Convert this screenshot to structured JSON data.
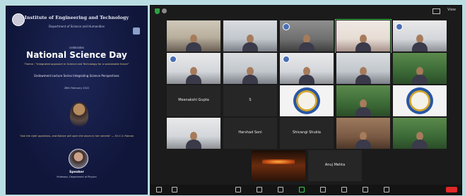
{
  "poster": {
    "institute": "Institute of Engineering and Technology",
    "department": "Department of Science and Humanities",
    "celebrates": "celebrates",
    "event_title": "National Science Day",
    "theme": "Theme : \"Integrated approach in Science and Technology for a sustainable future\"",
    "lecture": "Endowment Lecture Series Integrating Science Perspectives",
    "date": "28th February 2022",
    "quote": "\"Ask the right questions, and Nature will open the doors to her secrets\" — Sir C.V. Raman",
    "speaker_name": "Speaker",
    "speaker_role": "Professor, Department of Physics"
  },
  "meeting": {
    "view_label": "View",
    "tiles": [
      {
        "name": "",
        "style": "bg-room-a",
        "type": "person"
      },
      {
        "name": "",
        "style": "bg-room-b",
        "type": "person"
      },
      {
        "name": "",
        "style": "bg-room-c",
        "type": "logo-person"
      },
      {
        "name": "",
        "style": "bg-room-d",
        "type": "person",
        "active": true
      },
      {
        "name": "",
        "style": "bg-room-e",
        "type": "logo-person"
      },
      {
        "name": "",
        "style": "bg-room-e",
        "type": "logo-person"
      },
      {
        "name": "",
        "style": "bg-room-b",
        "type": "person"
      },
      {
        "name": "",
        "style": "bg-room-e",
        "type": "logo-person"
      },
      {
        "name": "",
        "style": "bg-room-b",
        "type": "person"
      },
      {
        "name": "",
        "style": "bg-green",
        "type": "person"
      },
      {
        "name": "Meenakshi Gupta",
        "style": "",
        "type": "text"
      },
      {
        "name": "S",
        "style": "",
        "type": "text"
      },
      {
        "name": "",
        "style": "bg-white",
        "type": "seal"
      },
      {
        "name": "",
        "style": "bg-green",
        "type": "person"
      },
      {
        "name": "",
        "style": "bg-white",
        "type": "seal"
      },
      {
        "name": "",
        "style": "bg-room-e",
        "type": "person"
      },
      {
        "name": "Harshad Soni",
        "style": "",
        "type": "text"
      },
      {
        "name": "Shivangi Shukla",
        "style": "",
        "type": "text"
      },
      {
        "name": "",
        "style": "bg-warm",
        "type": "person"
      },
      {
        "name": "",
        "style": "bg-green",
        "type": "person"
      },
      {
        "name": "",
        "style": "bg-orange",
        "type": "glow"
      },
      {
        "name": "Anuj Mehta",
        "style": "",
        "type": "text"
      }
    ]
  },
  "colors": {
    "page_bg": "#b9dde2",
    "poster_bg": "#10163a",
    "accent_gold": "#e0c98a",
    "zoom_bg": "#1b1b1b",
    "active_speaker": "#37d14f",
    "end_button": "#e02828"
  },
  "icons": [
    "shield-icon",
    "info-icon",
    "view-icon",
    "mic-icon",
    "video-icon",
    "security-icon",
    "participants-icon",
    "chat-icon",
    "share-screen-icon",
    "record-icon",
    "reactions-icon",
    "apps-icon",
    "whiteboard-icon"
  ]
}
